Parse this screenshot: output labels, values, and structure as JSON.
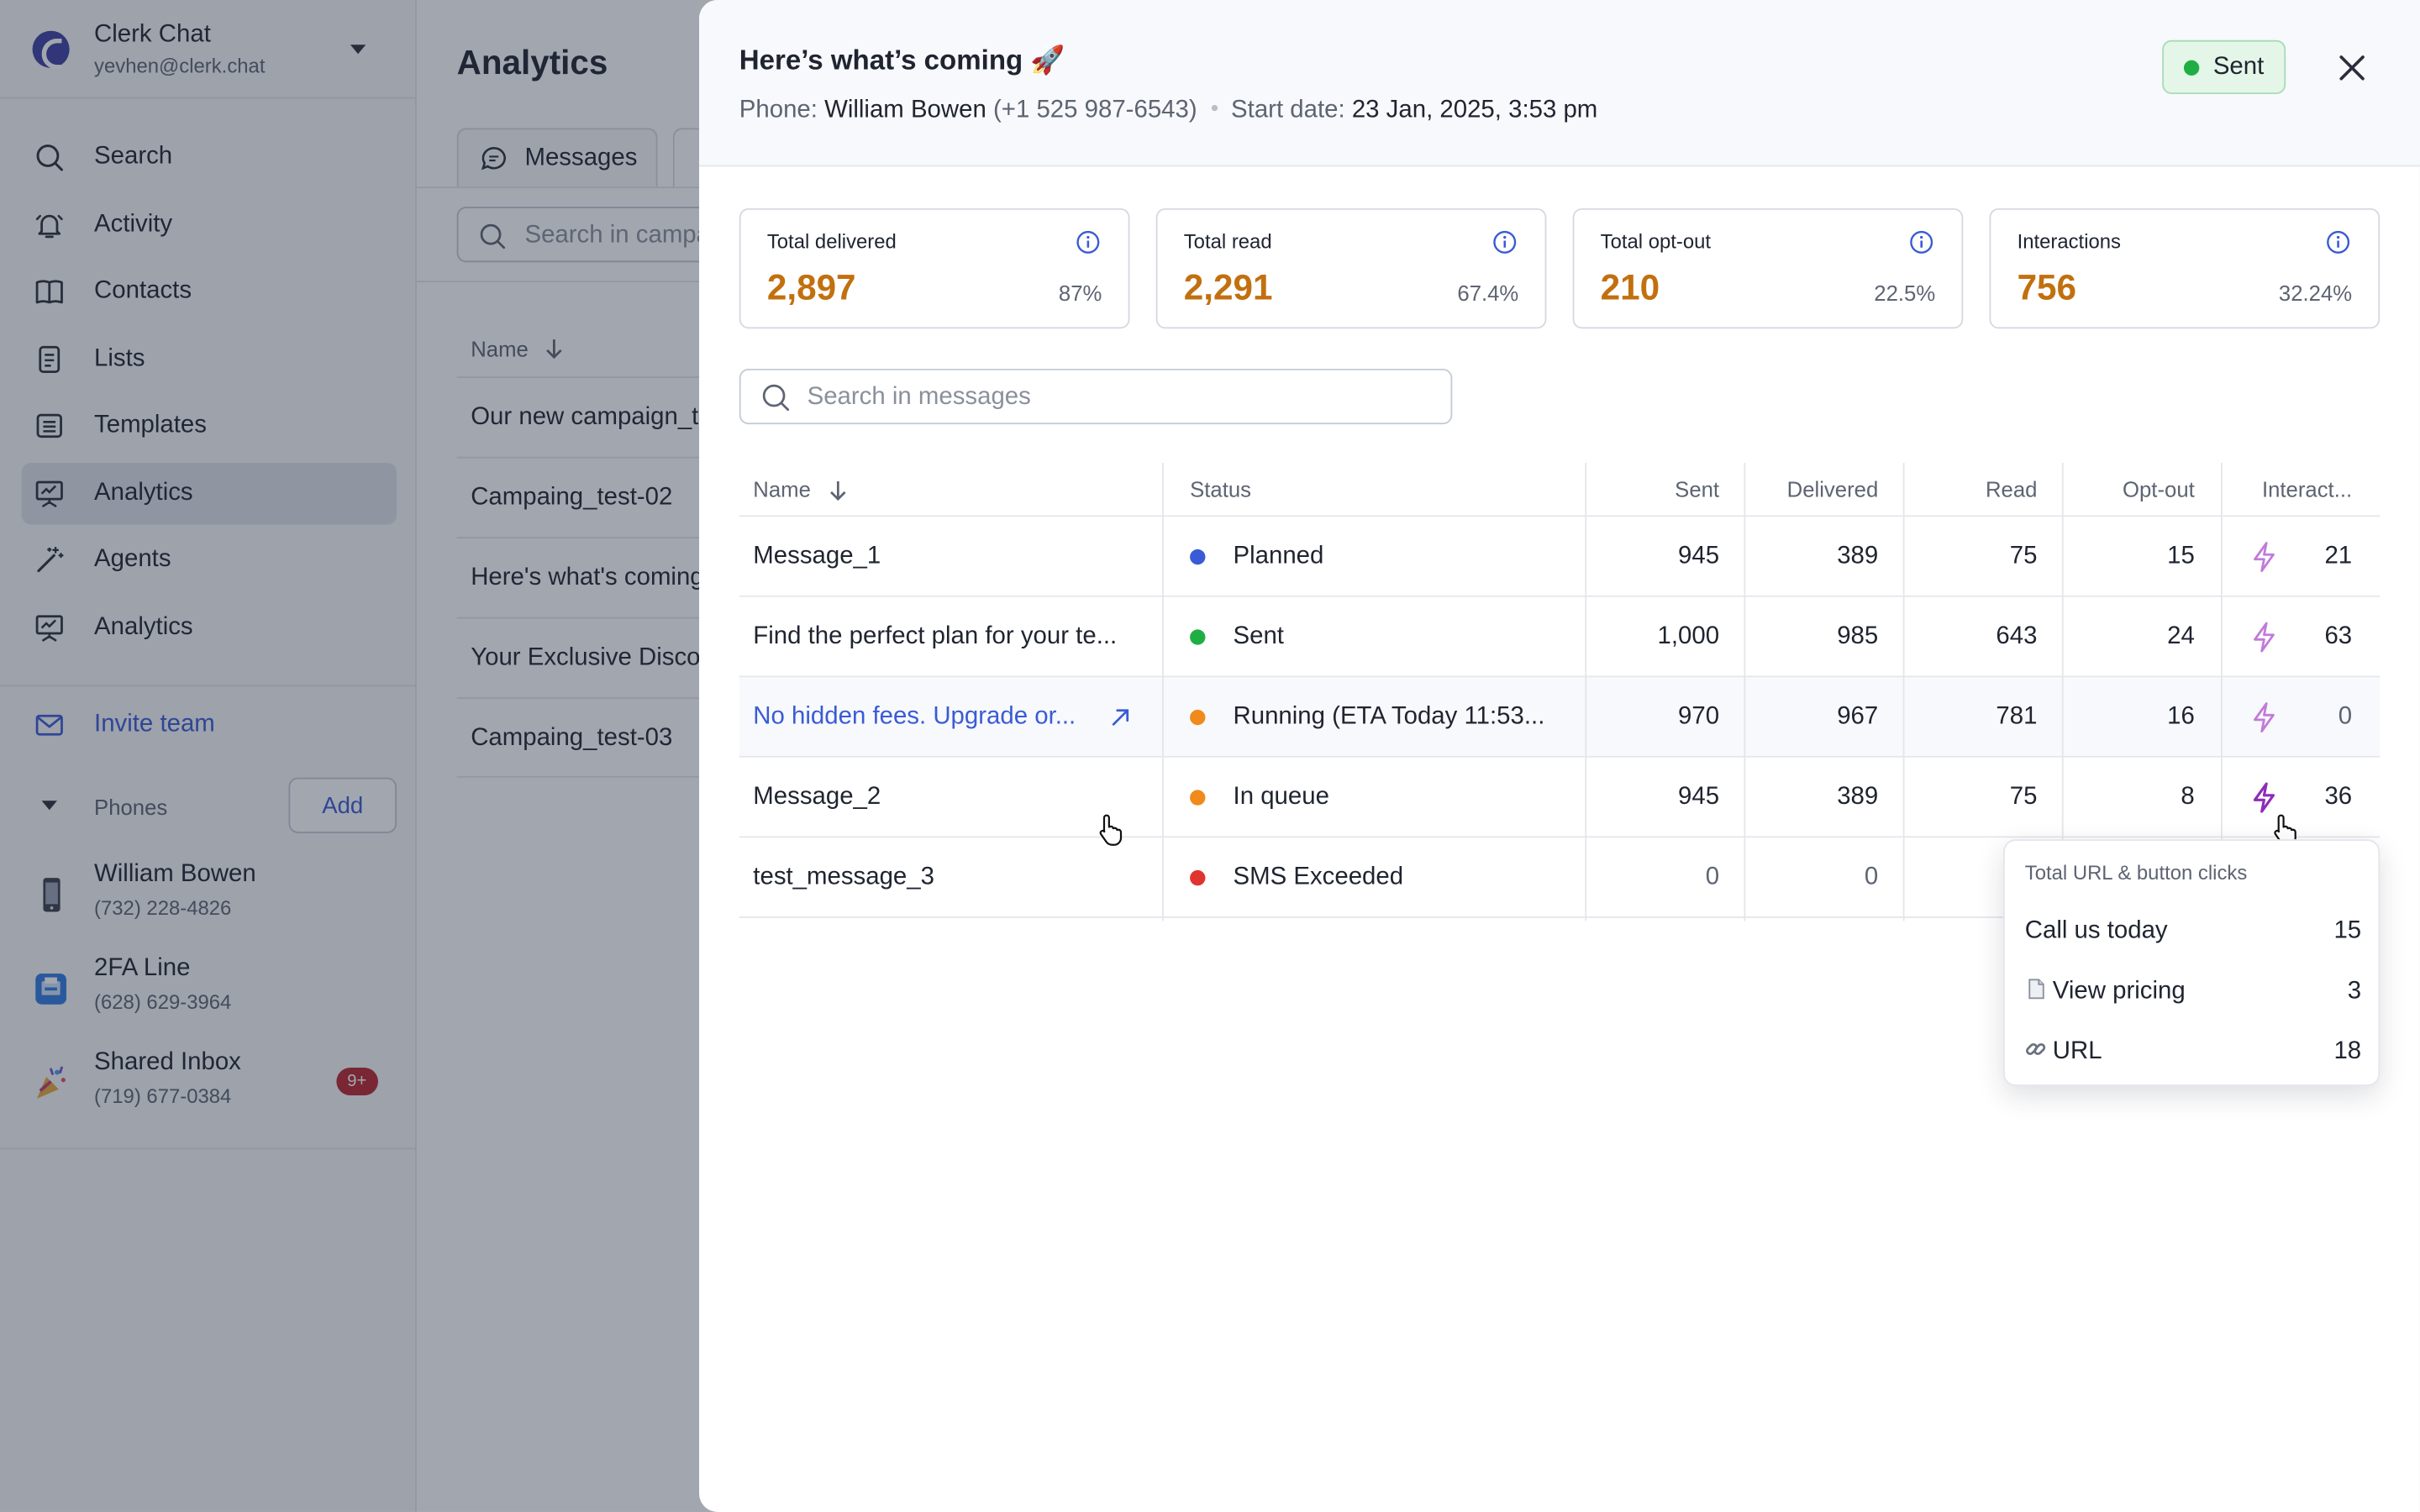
{
  "workspace": {
    "name": "Clerk Chat",
    "email": "yevhen@clerk.chat"
  },
  "sidebar": {
    "nav": [
      {
        "label": "Search",
        "icon": "search-icon"
      },
      {
        "label": "Activity",
        "icon": "bell-icon"
      },
      {
        "label": "Contacts",
        "icon": "book-icon"
      },
      {
        "label": "Lists",
        "icon": "list-icon"
      },
      {
        "label": "Templates",
        "icon": "template-icon"
      },
      {
        "label": "Analytics",
        "icon": "chart-board-icon",
        "active": true
      },
      {
        "label": "Agents",
        "icon": "magic-wand-icon"
      },
      {
        "label": "Analytics",
        "icon": "chart-board-icon"
      }
    ],
    "invite_label": "Invite team",
    "phones_label": "Phones",
    "add_label": "Add",
    "phones": [
      {
        "name": "William Bowen",
        "number": "(732) 228-4826",
        "icon": "mobile-phone-icon"
      },
      {
        "name": "2FA Line",
        "number": "(628) 629-3964",
        "icon": "fax-icon"
      },
      {
        "name": "Shared Inbox",
        "number": "(719) 677-0384",
        "icon": "party-popper-icon",
        "badge": "9+"
      }
    ]
  },
  "background": {
    "title": "Analytics",
    "tab_label": "Messages",
    "search_placeholder": "Search in campaigns",
    "name_header": "Name",
    "rows": [
      "Our new campaign_test",
      "Campaing_test-02",
      "Here's what's coming",
      "Your Exclusive Discount",
      "Campaing_test-03"
    ]
  },
  "panel": {
    "title": "Here’s what’s coming 🚀",
    "phone_label": "Phone:",
    "phone_name": "William Bowen",
    "phone_number": "(+1 525 987-6543)",
    "start_label": "Start date:",
    "start_value": "23 Jan, 2025, 3:53 pm",
    "status_badge": "Sent",
    "colors": {
      "accent": "#c2700f",
      "link": "#3a5bd6",
      "sent": "#1fae44",
      "planned": "#3a5bd6",
      "running": "#f08a1c",
      "exceeded": "#e0352e",
      "bolt": "#b448d6"
    }
  },
  "kpis": [
    {
      "label": "Total delivered",
      "value": "2,897",
      "pct": "87%"
    },
    {
      "label": "Total read",
      "value": "2,291",
      "pct": "67.4%"
    },
    {
      "label": "Total opt-out",
      "value": "210",
      "pct": "22.5%"
    },
    {
      "label": "Interactions",
      "value": "756",
      "pct": "32.24%"
    }
  ],
  "messages": {
    "search_placeholder": "Search in messages",
    "columns": [
      "Name",
      "Status",
      "Sent",
      "Delivered",
      "Read",
      "Opt-out",
      "Interact..."
    ],
    "rows": [
      {
        "name": "Message_1",
        "status": "Planned",
        "status_color": "#3a5bd6",
        "sent": "945",
        "delivered": "389",
        "read": "75",
        "optout": "15",
        "interactions": "21"
      },
      {
        "name": "Find the perfect plan for your te...",
        "status": "Sent",
        "status_color": "#1fae44",
        "sent": "1,000",
        "delivered": "985",
        "read": "643",
        "optout": "24",
        "interactions": "63"
      },
      {
        "name": "No hidden fees. Upgrade or...",
        "status": "Running (ETA Today 11:53...",
        "status_color": "#f08a1c",
        "sent": "970",
        "delivered": "967",
        "read": "781",
        "optout": "16",
        "interactions": "0",
        "link": true
      },
      {
        "name": "Message_2",
        "status": "In queue",
        "status_color": "#f08a1c",
        "sent": "945",
        "delivered": "389",
        "read": "75",
        "optout": "8",
        "interactions": "36"
      },
      {
        "name": "test_message_3",
        "status": "SMS Exceeded",
        "status_color": "#e0352e",
        "sent": "0",
        "delivered": "0"
      }
    ]
  },
  "tooltip": {
    "title": "Total URL & button clicks",
    "items": [
      {
        "label": "Call us today",
        "value": "15"
      },
      {
        "label": "View pricing",
        "value": "3",
        "icon": "document-icon"
      },
      {
        "label": "URL",
        "value": "18",
        "icon": "link-icon"
      }
    ]
  }
}
